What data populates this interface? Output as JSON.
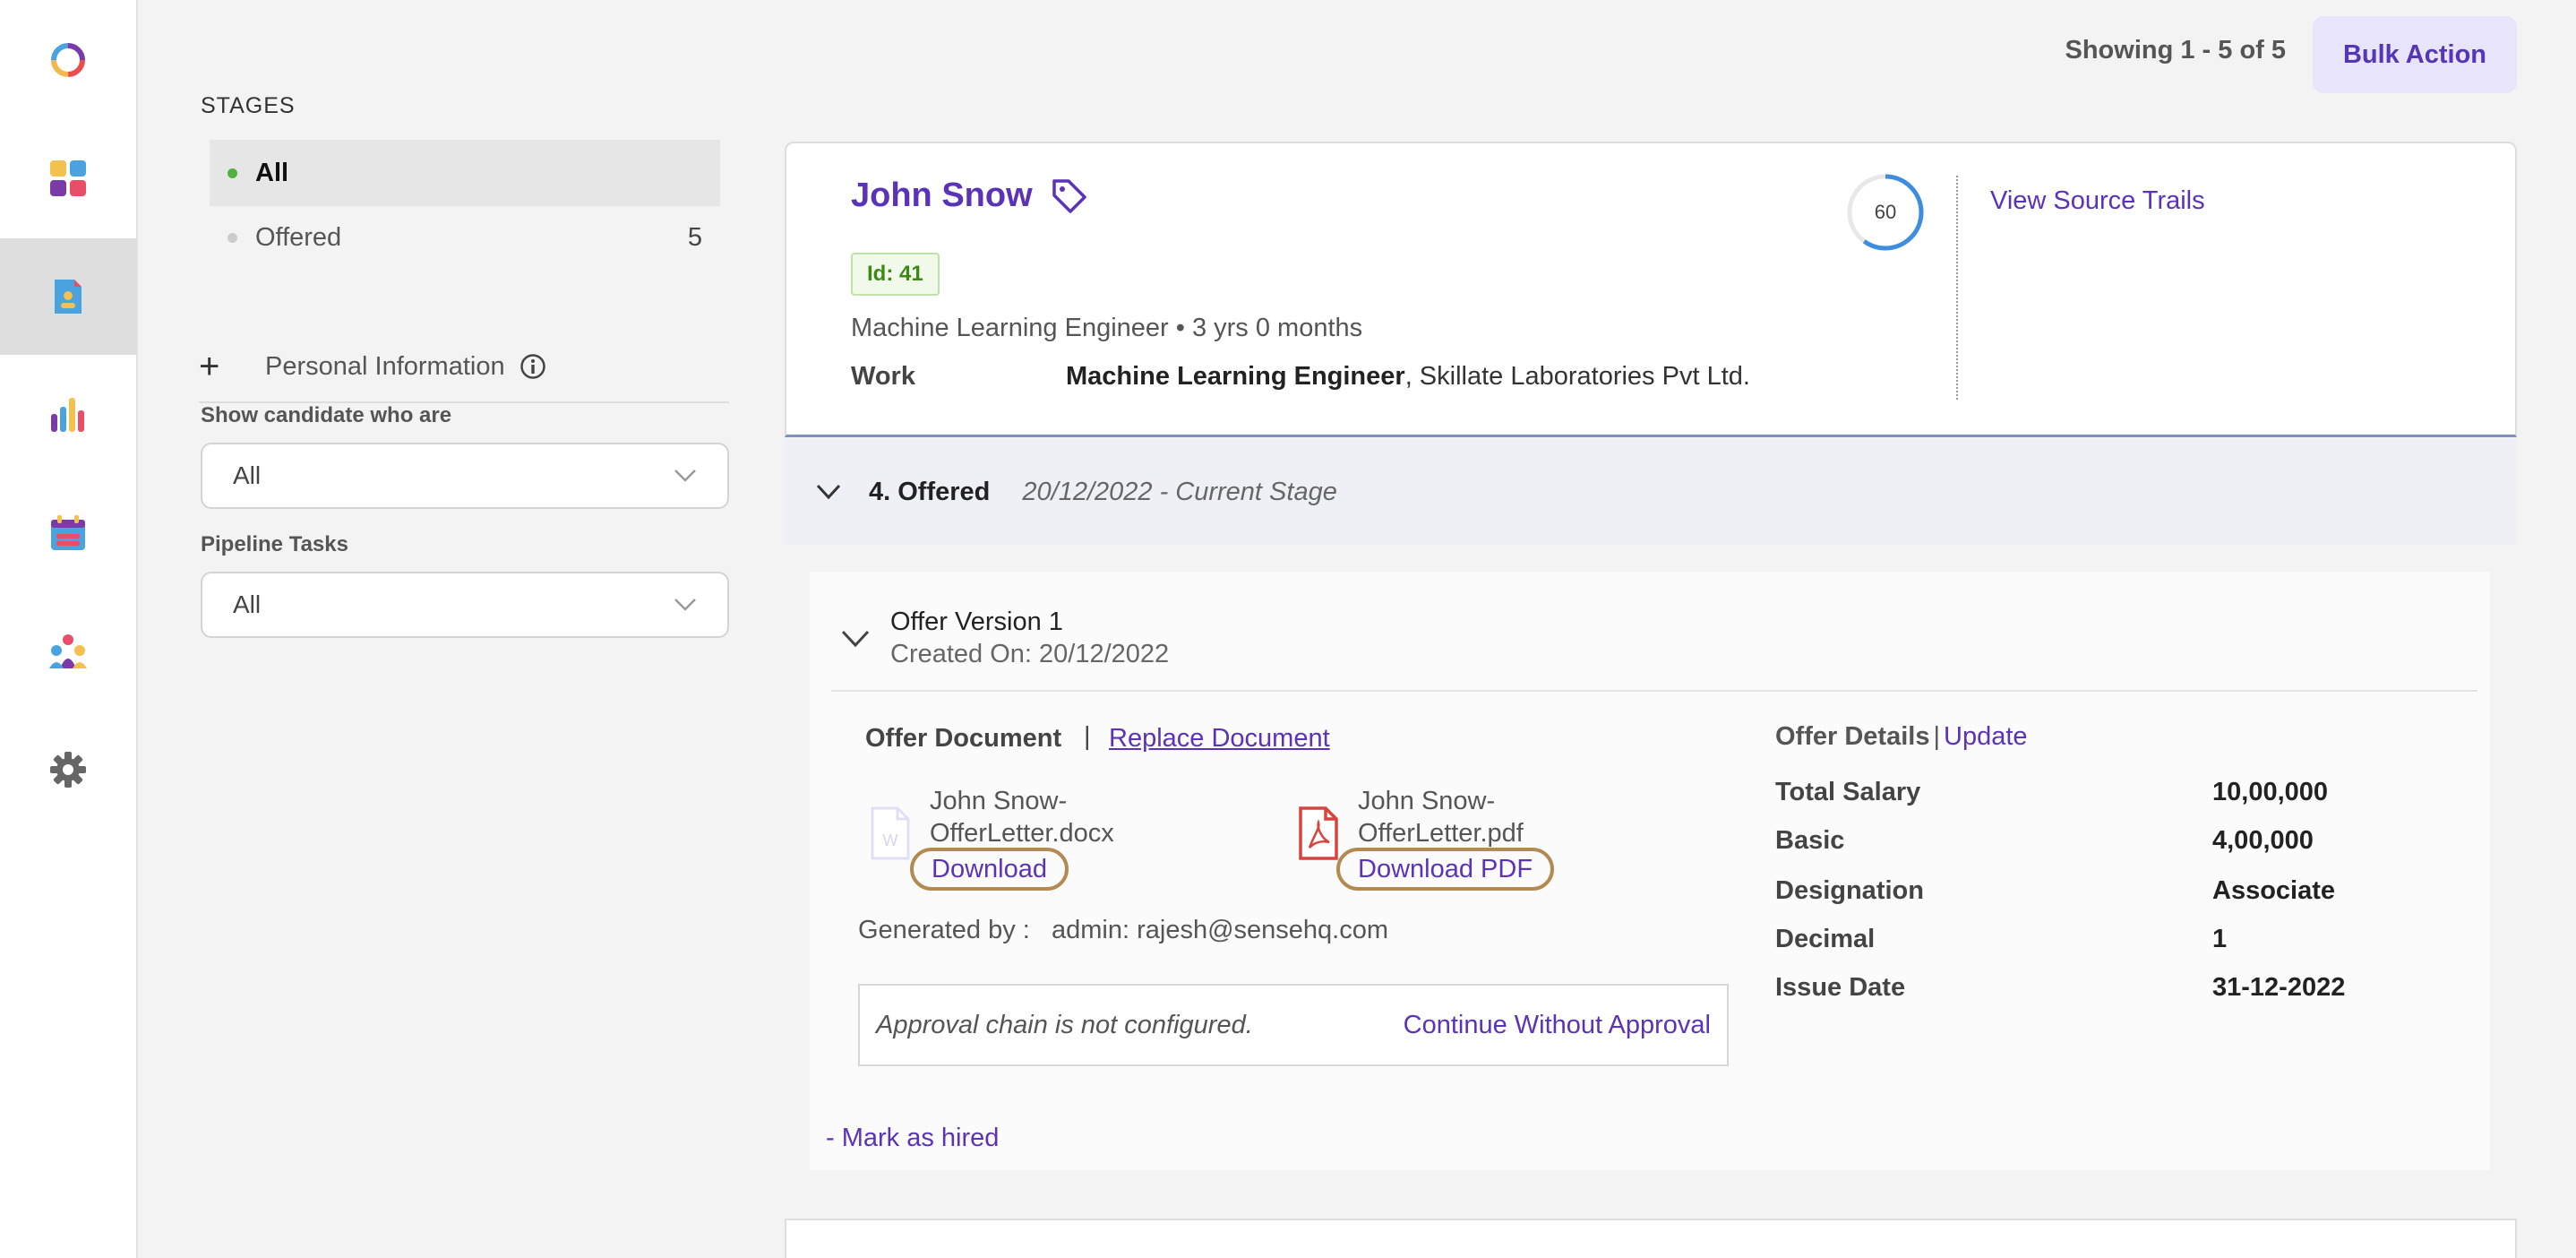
{
  "stages": {
    "title": "STAGES",
    "items": [
      {
        "label": "All",
        "count": "",
        "dot_color": "#52b043"
      },
      {
        "label": "Offered",
        "count": "5",
        "dot_color": "#cccccc"
      }
    ]
  },
  "filters": {
    "personal_info_label": "Personal Information",
    "show_candidate_label": "Show candidate who are",
    "show_candidate_value": "All",
    "pipeline_tasks_label": "Pipeline Tasks",
    "pipeline_tasks_value": "All"
  },
  "header": {
    "showing": "Showing 1 - 5 of 5",
    "bulk_action": "Bulk Action"
  },
  "candidate": {
    "name": "John Snow",
    "id_badge": "Id: 41",
    "role_line": "Machine Learning Engineer • 3 yrs 0 months",
    "work_label": "Work",
    "work_title": "Machine Learning Engineer",
    "work_company": ", Skillate Laboratories Pvt Ltd.",
    "score": "60",
    "score_fraction": 0.6,
    "view_source_trails": "View Source Trails"
  },
  "stage": {
    "name": "4. Offered",
    "date": "20/12/2022 - Current Stage"
  },
  "offer": {
    "version_title": "Offer Version 1",
    "created_on": "Created On: 20/12/2022",
    "document_label": "Offer Document",
    "separator": "|",
    "replace_document": "Replace Document",
    "files": [
      {
        "name_line1": "John Snow-",
        "name_line2": "OfferLetter.docx",
        "action": "Download"
      },
      {
        "name_line1": "John Snow-",
        "name_line2": "OfferLetter.pdf",
        "action": "Download PDF"
      }
    ],
    "generated_by_label": "Generated by :",
    "generated_by_value": "admin: rajesh@sensehq.com",
    "approval_message": "Approval chain is not configured.",
    "continue_without_approval": "Continue Without Approval",
    "mark_as_hired": "- Mark as hired"
  },
  "offer_details": {
    "title": "Offer Details",
    "separator": "|",
    "update": "Update",
    "rows": [
      {
        "key": "Total Salary",
        "value": "10,00,000"
      },
      {
        "key": "Basic",
        "value": "4,00,000"
      },
      {
        "key": "Designation",
        "value": "Associate"
      },
      {
        "key": "Decimal",
        "value": "1"
      },
      {
        "key": "Issue Date",
        "value": "31-12-2022"
      }
    ]
  },
  "colors": {
    "accent": "#5a33b8",
    "highlight_ring": "#b28a52"
  }
}
